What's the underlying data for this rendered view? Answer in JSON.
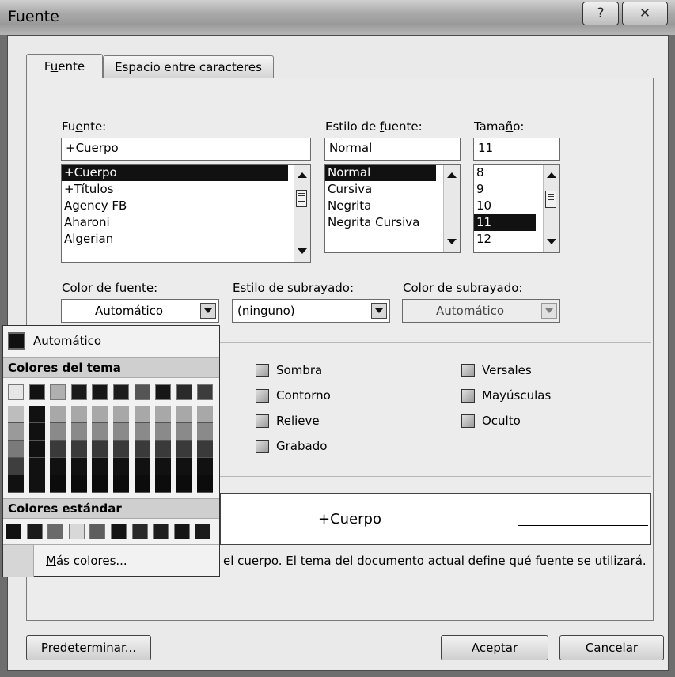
{
  "window": {
    "title": "Fuente",
    "help_label": "?",
    "close_label": "✕"
  },
  "tabs": [
    {
      "label": "Fuente",
      "active": true
    },
    {
      "label": "Espacio entre caracteres",
      "active": false
    }
  ],
  "font": {
    "label": "Fuente:",
    "value": "+Cuerpo",
    "list": [
      "+Cuerpo",
      "+Títulos",
      "Agency FB",
      "Aharoni",
      "Algerian"
    ],
    "selected_index": 0
  },
  "style": {
    "label": "Estilo de fuente:",
    "value": "Normal",
    "list": [
      "Normal",
      "Cursiva",
      "Negrita",
      "Negrita Cursiva"
    ],
    "selected_index": 0
  },
  "size": {
    "label": "Tamaño:",
    "value": "11",
    "list": [
      "8",
      "9",
      "10",
      "11",
      "12"
    ],
    "selected_index": 3
  },
  "font_color": {
    "label": "Color de fuente:",
    "value": "Automático"
  },
  "underline_style": {
    "label": "Estilo de subrayado:",
    "value": "(ninguno)"
  },
  "underline_color": {
    "label": "Color de subrayado:",
    "value": "Automático"
  },
  "effects": {
    "col2": [
      {
        "label": "Sombra",
        "checked": false
      },
      {
        "label": "Contorno",
        "checked": false
      },
      {
        "label": "Relieve",
        "checked": false
      },
      {
        "label": "Grabado",
        "checked": false
      }
    ],
    "col3": [
      {
        "label": "Versales",
        "checked": false
      },
      {
        "label": "Mayúsculas",
        "checked": false
      },
      {
        "label": "Oculto",
        "checked": false
      }
    ]
  },
  "preview": {
    "text": "+Cuerpo",
    "description": "el cuerpo. El tema del documento actual define qué fuente se utilizará."
  },
  "color_popup": {
    "automatic_label": "Automático",
    "theme_header": "Colores del tema",
    "standard_header": "Colores estándar",
    "more_colors_label": "Más colores...",
    "theme_top_row": [
      "#e6e6e6",
      "#111111",
      "#b0b0b0",
      "#1a1a1a",
      "#151515",
      "#1c1c1c",
      "#555555",
      "#161616",
      "#2a2a2a",
      "#3c3c3c"
    ],
    "standard_row": [
      "#111111",
      "#1a1a1a",
      "#6a6a6a",
      "#d8d8d8",
      "#5e5e5e",
      "#141414",
      "#2a2a2a",
      "#1e1e1e",
      "#151515",
      "#1b1b1b"
    ]
  },
  "buttons": {
    "default": "Predeterminar...",
    "ok": "Aceptar",
    "cancel": "Cancelar"
  }
}
